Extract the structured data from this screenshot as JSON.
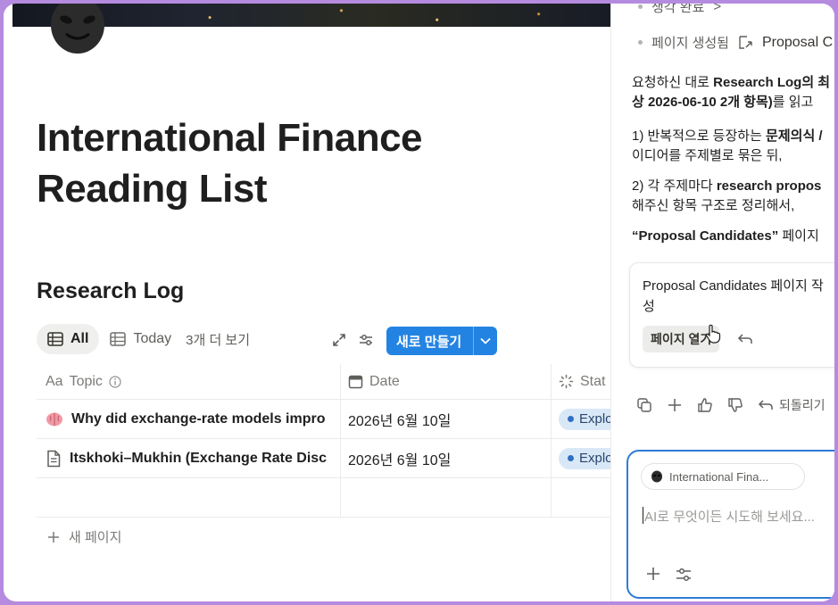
{
  "page": {
    "title": "International Finance Reading List",
    "icon": "alien-face-icon"
  },
  "database": {
    "title": "Research Log",
    "views": [
      {
        "label": "All",
        "active": true,
        "icon": "table-icon"
      },
      {
        "label": "Today",
        "active": false,
        "icon": "table-icon"
      }
    ],
    "more_views": "3개 더 보기",
    "new_button": "새로 만들기",
    "columns": [
      {
        "label": "Topic",
        "icon": "text-type-icon"
      },
      {
        "label": "Date",
        "icon": "calendar-icon"
      },
      {
        "label": "Stat",
        "icon": "status-spinner-icon"
      }
    ],
    "rows": [
      {
        "icon": "brain-icon",
        "title": "Why did exchange-rate models impro",
        "date": "2026년 6월 10일",
        "status": "Explo"
      },
      {
        "icon": "document-icon",
        "title": "Itskhoki–Mukhin (Exchange Rate Disc",
        "date": "2026년 6월 10일",
        "status": "Explo"
      }
    ],
    "new_page": "새 페이지",
    "status_color": "#2e6fc5"
  },
  "assistant": {
    "steps": [
      {
        "label": "생각 완료",
        "suffix": ">"
      },
      {
        "label": "페이지 생성됨",
        "link": "Proposal C"
      }
    ],
    "message": {
      "p1_a": "요청하신 대로 ",
      "p1_b": "Research Log의 최",
      "p1_c": "상 2026-06-10 2개 항목)",
      "p1_d": "를 읽고",
      "p2_a": "1) 반복적으로 등장하는 ",
      "p2_b": "문제의식 / ",
      "p2_c": "이디어를 주제별로 묶은 뒤,",
      "p3_a": "2) 각 주제마다 ",
      "p3_b": "research propos",
      "p3_c": "해주신 항목 구조로 정리해서,",
      "p4_a": "“Proposal Candidates”",
      "p4_b": " 페이지"
    },
    "card": {
      "title": "Proposal Candidates 페이지 작성",
      "button": "페이지 열기"
    },
    "undo_label": "되돌리기",
    "composer": {
      "context_chip": "International Fina...",
      "placeholder": "AI로 무엇이든 시도해 보세요..."
    },
    "accent": "#2e7bd6"
  },
  "colors": {
    "frame": "#b58be0",
    "primary_button": "#2383e2"
  }
}
